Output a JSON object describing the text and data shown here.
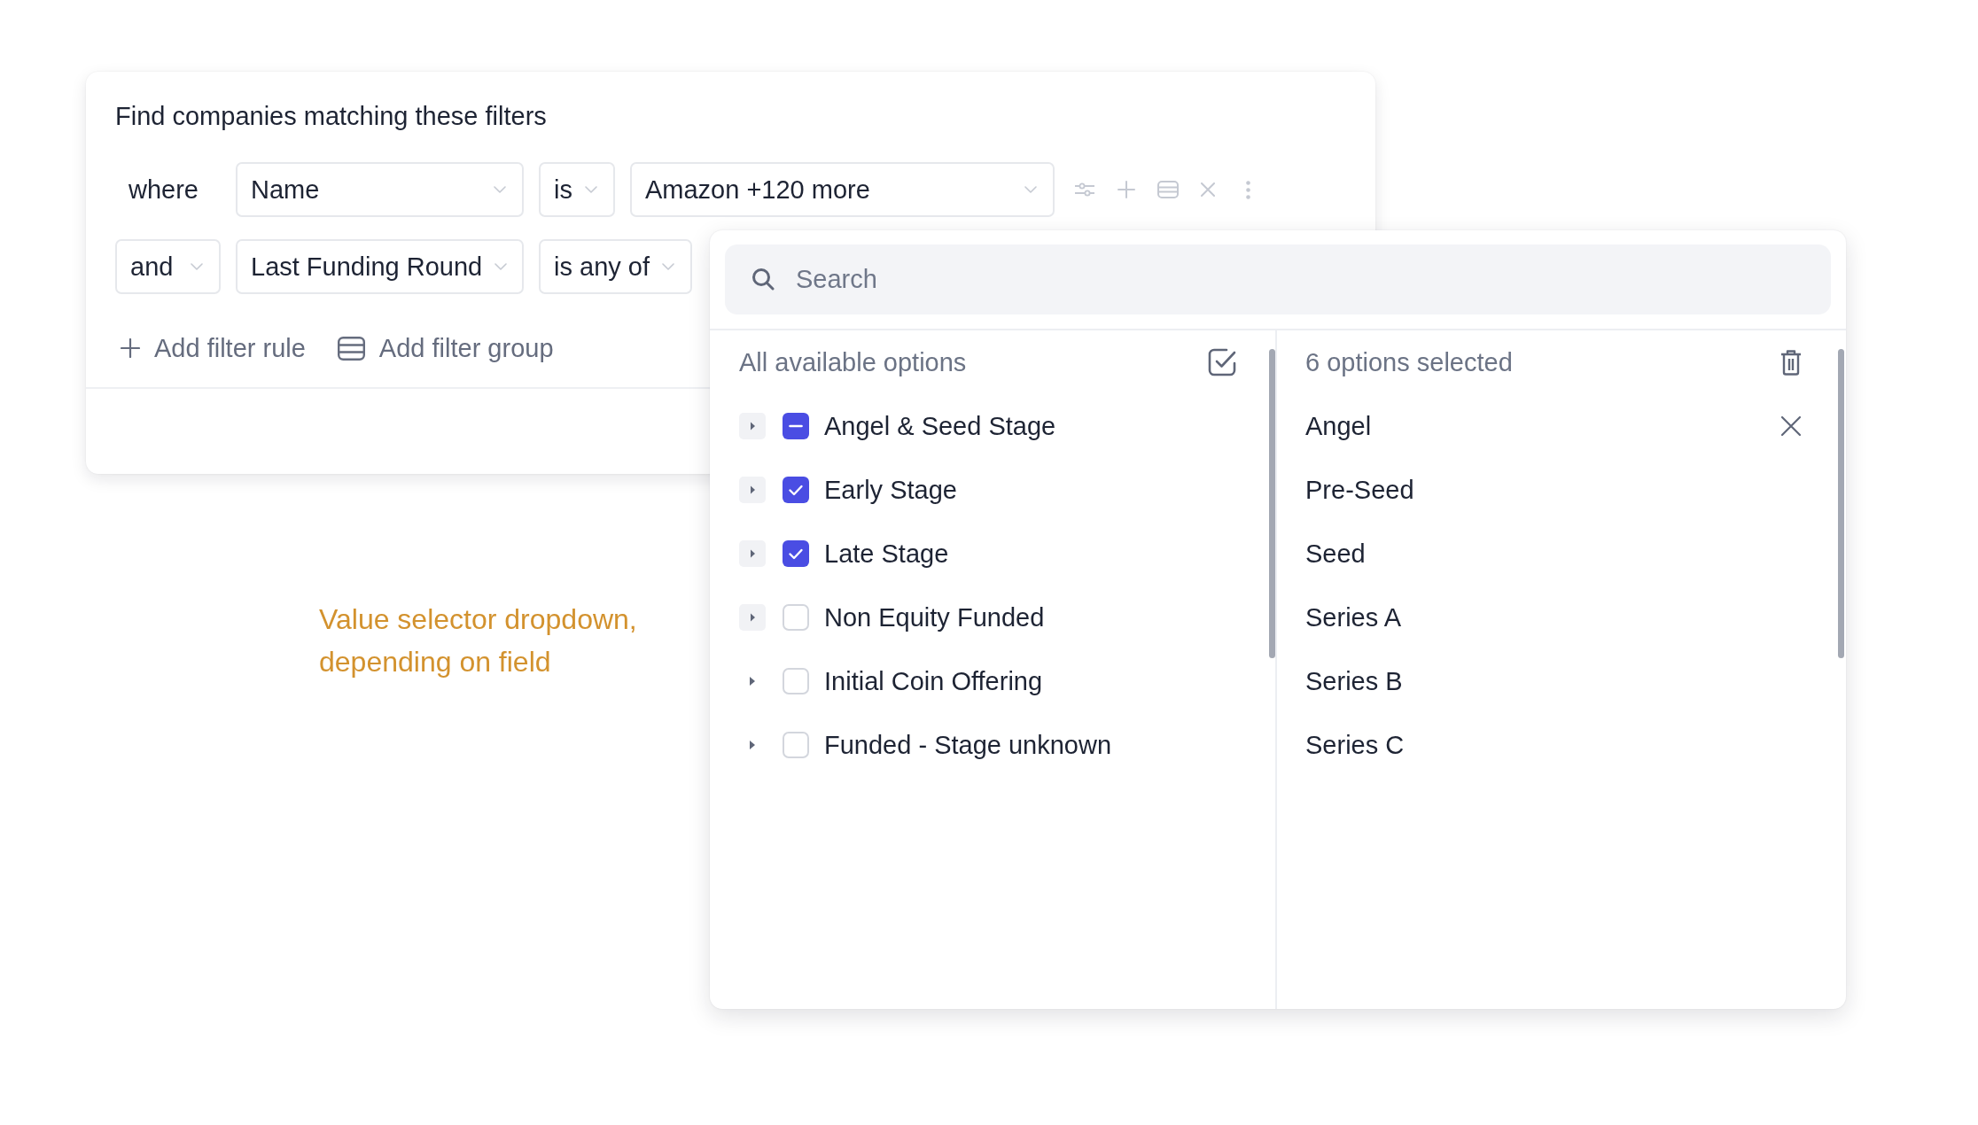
{
  "filter_panel": {
    "title": "Find companies matching these filters",
    "rules": [
      {
        "connector": {
          "kind": "text",
          "label": "where"
        },
        "field": "Name",
        "operator": "is",
        "value": "Amazon +120 more"
      },
      {
        "connector": {
          "kind": "select",
          "label": "and"
        },
        "field": "Last Funding Round",
        "operator": "is any of"
      }
    ],
    "add_actions": [
      {
        "kind": "rule",
        "label": "Add filter rule"
      },
      {
        "kind": "group",
        "label": "Add filter group"
      }
    ]
  },
  "value_dropdown": {
    "search": {
      "placeholder": "Search"
    },
    "available": {
      "heading": "All available options",
      "options": [
        {
          "label": "Angel & Seed Stage",
          "checked": true,
          "partial": true,
          "expander_shaded": true
        },
        {
          "label": "Early Stage",
          "checked": true,
          "partial": false,
          "expander_shaded": true
        },
        {
          "label": "Late Stage",
          "checked": true,
          "partial": false,
          "expander_shaded": true
        },
        {
          "label": "Non Equity Funded",
          "checked": false,
          "partial": false,
          "expander_shaded": true
        },
        {
          "label": "Initial Coin Offering",
          "checked": false,
          "partial": false,
          "expander_shaded": false
        },
        {
          "label": "Funded - Stage unknown",
          "checked": false,
          "partial": false,
          "expander_shaded": false
        }
      ]
    },
    "selected": {
      "heading": "6 options selected",
      "items": [
        {
          "label": "Angel",
          "hovered": true
        },
        {
          "label": "Pre-Seed",
          "hovered": false
        },
        {
          "label": "Seed",
          "hovered": false
        },
        {
          "label": "Series A",
          "hovered": false
        },
        {
          "label": "Series B",
          "hovered": false
        },
        {
          "label": "Series C",
          "hovered": false
        }
      ]
    }
  },
  "annotation": "Value selector dropdown, depending on field"
}
